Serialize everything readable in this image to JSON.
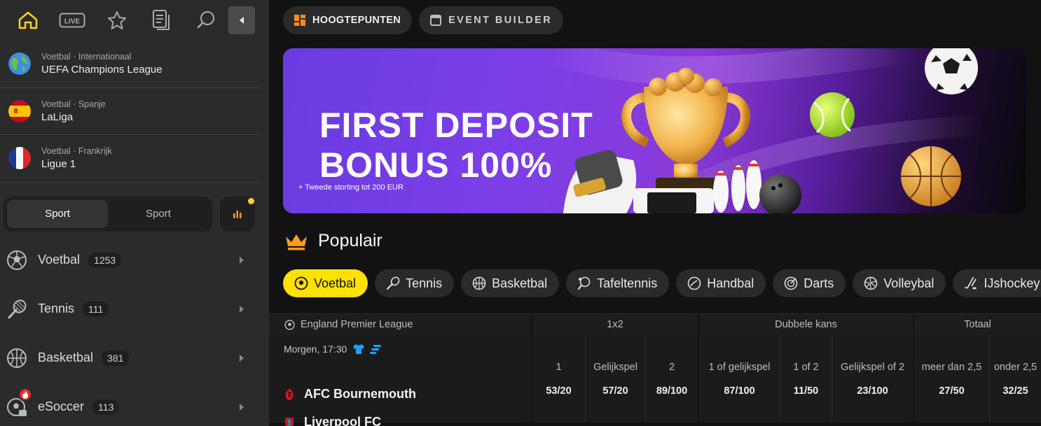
{
  "sidebar": {
    "favorites": [
      {
        "meta_sport": "Voetbal",
        "meta_region": "Internationaal",
        "name": "UEFA Champions League"
      },
      {
        "meta_sport": "Voetbal",
        "meta_region": "Spanje",
        "name": "LaLiga"
      },
      {
        "meta_sport": "Voetbal",
        "meta_region": "Frankrijk",
        "name": "Ligue 1"
      }
    ],
    "toggle": {
      "left": "Sport",
      "right": "Sport"
    },
    "sports": [
      {
        "name": "Voetbal",
        "count": "1253",
        "icon": "football-icon"
      },
      {
        "name": "Tennis",
        "count": "111",
        "icon": "tennis-icon"
      },
      {
        "name": "Basketbal",
        "count": "381",
        "icon": "basketball-icon"
      },
      {
        "name": "eSoccer",
        "count": "113",
        "icon": "esoccer-icon"
      }
    ],
    "colors": {
      "accent": "#ffe100",
      "home": "#ffd21f"
    }
  },
  "main": {
    "tabs": [
      {
        "label": "HOOGTEPUNTEN",
        "icon": "grid-icon"
      },
      {
        "label": "EVENT BUILDER",
        "icon": "window-icon"
      }
    ],
    "banner": {
      "line1": "FIRST DEPOSIT",
      "line2": "BONUS 100%",
      "sub": "+ Tweede storting tot 200 EUR"
    },
    "popular_title": "Populair",
    "chips": [
      {
        "label": "Voetbal",
        "active": true
      },
      {
        "label": "Tennis"
      },
      {
        "label": "Basketbal"
      },
      {
        "label": "Tafeltennis"
      },
      {
        "label": "Handbal"
      },
      {
        "label": "Darts"
      },
      {
        "label": "Volleybal"
      },
      {
        "label": "IJshockey"
      }
    ],
    "table": {
      "league": "England Premier League",
      "groups": [
        "1x2",
        "Dubbele kans",
        "Totaal"
      ],
      "match": {
        "time": "Morgen, 17:30",
        "home": "AFC Bournemouth",
        "away": "Liverpool FC"
      },
      "odds": [
        {
          "label": "1",
          "value": "53/20"
        },
        {
          "label": "Gelijkspel",
          "value": "57/20"
        },
        {
          "label": "2",
          "value": "89/100"
        },
        {
          "label": "1 of gelijkspel",
          "value": "87/100"
        },
        {
          "label": "1 of 2",
          "value": "11/50"
        },
        {
          "label": "Gelijkspel of 2",
          "value": "23/100"
        },
        {
          "label": "meer dan 2,5",
          "value": "27/50"
        },
        {
          "label": "onder 2,5",
          "value": "32/25"
        }
      ]
    }
  }
}
